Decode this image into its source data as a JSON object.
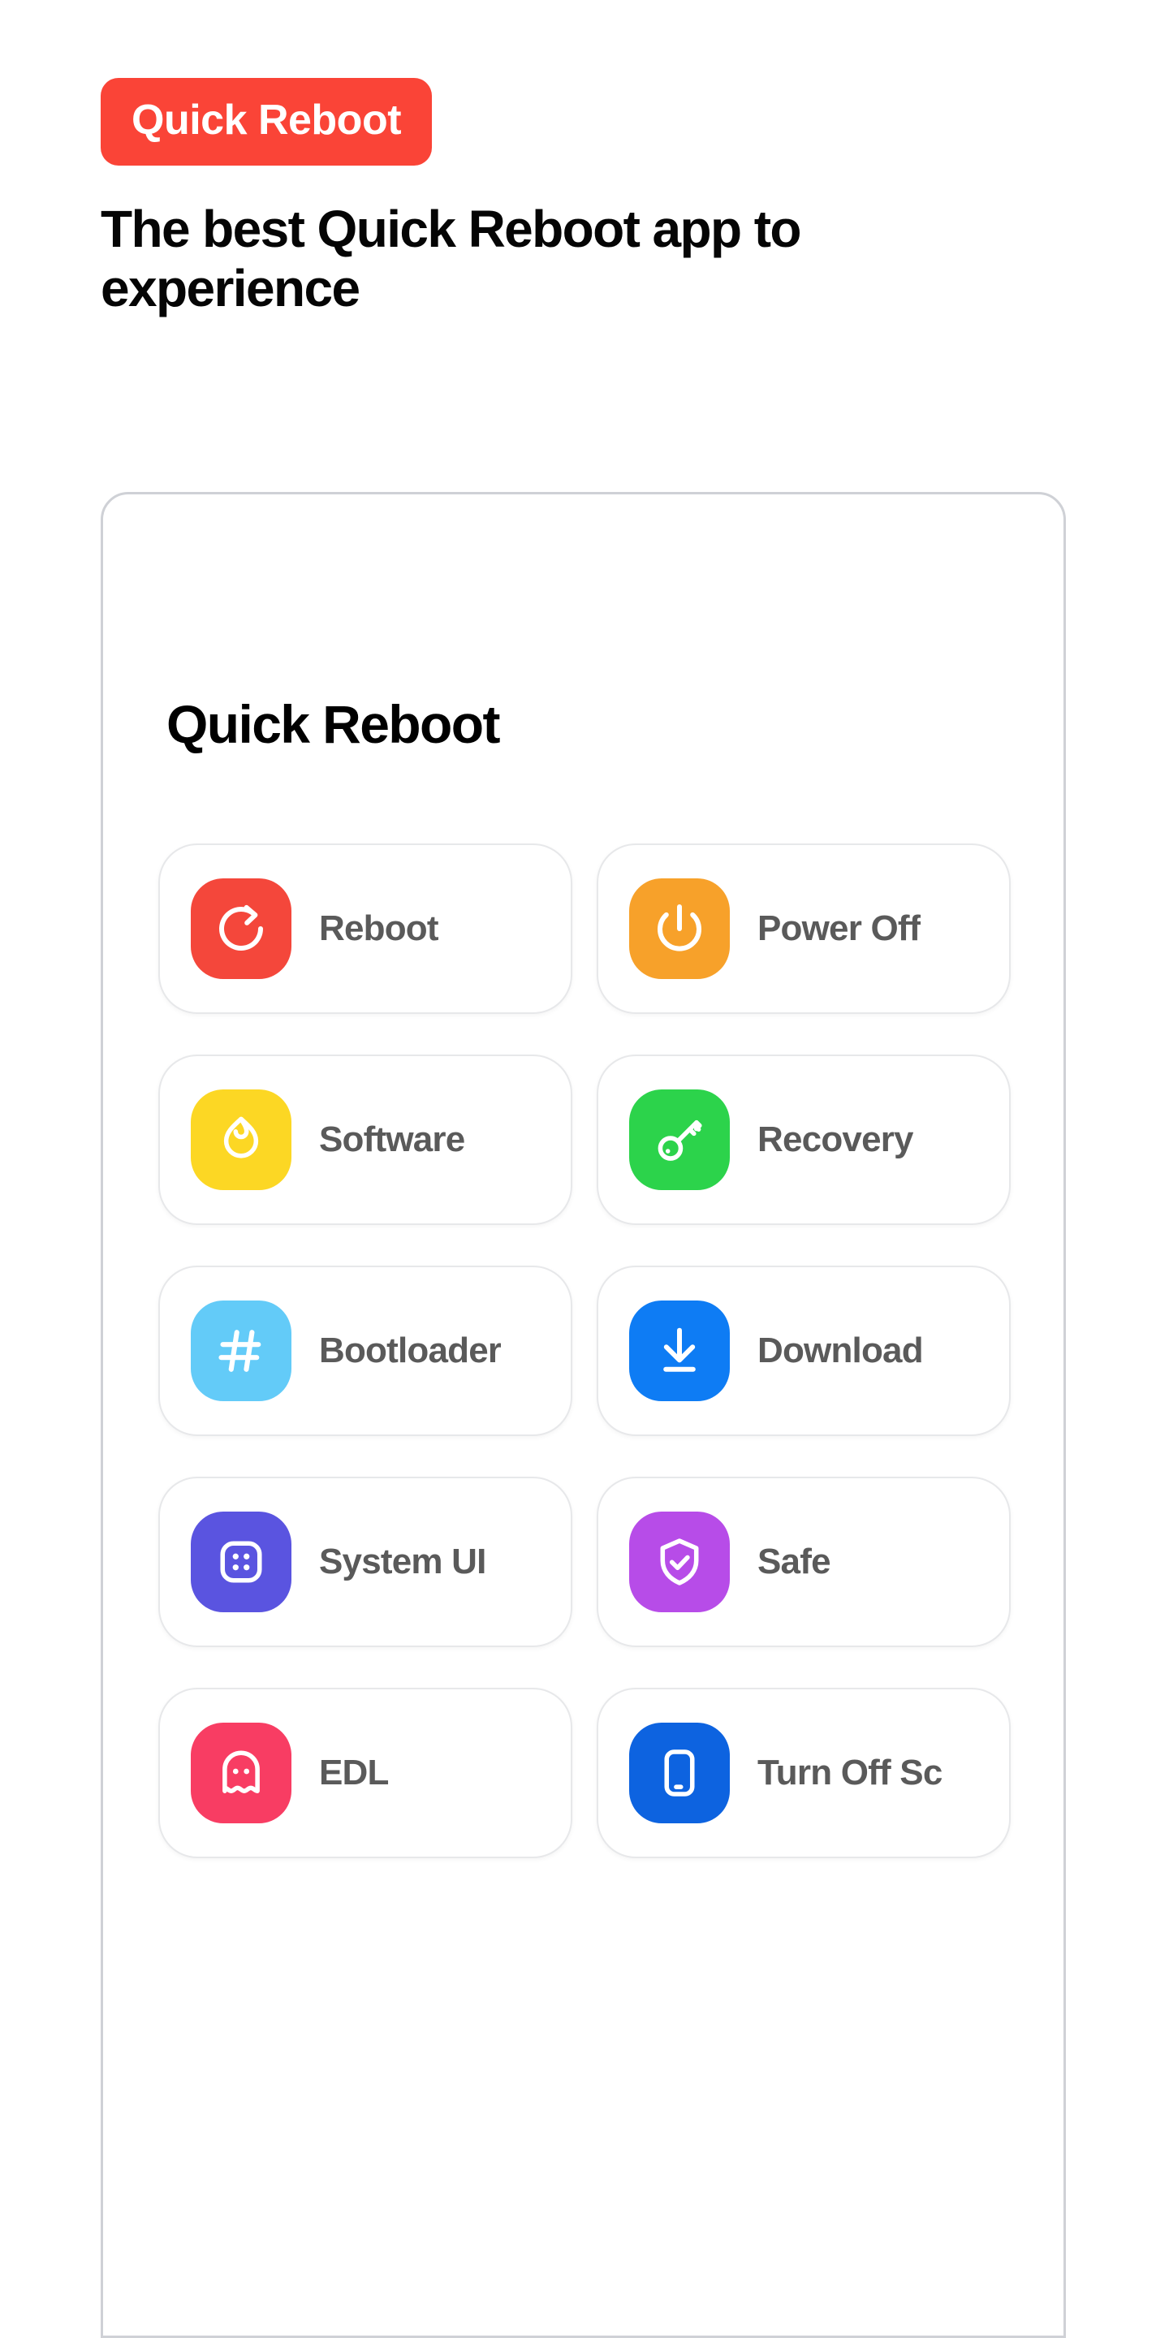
{
  "hero": {
    "badge_label": "Quick Reboot",
    "badge_color": "#fa4437",
    "headline": "The best Quick Reboot app to experience"
  },
  "card": {
    "title": "Quick Reboot",
    "border_color": "#cfd1d6",
    "actions": [
      {
        "label": "Reboot",
        "icon": "reboot-circular-arrow-icon",
        "tile_color": "#f4473b"
      },
      {
        "label": "Power Off",
        "icon": "power-icon",
        "tile_color": "#f7a12a"
      },
      {
        "label": "Software",
        "icon": "flame-icon",
        "tile_color": "#fcd724"
      },
      {
        "label": "Recovery",
        "icon": "key-icon",
        "tile_color": "#2cd34b"
      },
      {
        "label": "Bootloader",
        "icon": "hash-icon",
        "tile_color": "#63cbf8"
      },
      {
        "label": "Download",
        "icon": "download-arrow-icon",
        "tile_color": "#0e7cf4"
      },
      {
        "label": "System UI",
        "icon": "four-dots-square-icon",
        "tile_color": "#5a54e0"
      },
      {
        "label": "Safe",
        "icon": "shield-check-icon",
        "tile_color": "#b74ce8"
      },
      {
        "label": "EDL",
        "icon": "ghost-icon",
        "tile_color": "#f83d63"
      },
      {
        "label": "Turn Off Sc",
        "icon": "smartphone-icon",
        "tile_color": "#0d63e0"
      }
    ]
  }
}
